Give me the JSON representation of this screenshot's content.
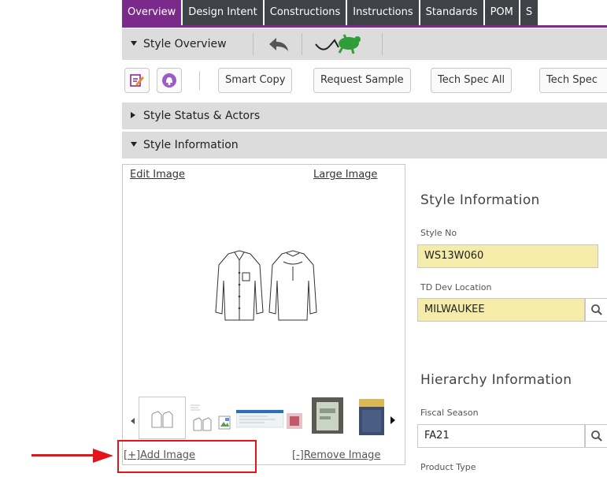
{
  "tabs": [
    {
      "label": "Overview",
      "active": true
    },
    {
      "label": "Design Intent",
      "active": false
    },
    {
      "label": "Constructions",
      "active": false
    },
    {
      "label": "Instructions",
      "active": false
    },
    {
      "label": "Standards",
      "active": false
    },
    {
      "label": "POM",
      "active": false
    },
    {
      "label": "S",
      "active": false
    }
  ],
  "style_overview": {
    "label": "Style Overview",
    "back_icon": "back-arrow-icon",
    "logo_icon": "frog-logo-icon"
  },
  "toolbar": {
    "edit_icon": "edit-note-icon",
    "alert_icon": "bell-icon",
    "smart_copy": "Smart Copy",
    "request_sample": "Request Sample",
    "tech_spec_all": "Tech Spec All",
    "tech_spec": "Tech Spec"
  },
  "sections": {
    "status_actors": "Style Status & Actors",
    "style_information": "Style Information"
  },
  "image_panel": {
    "edit_image": "Edit Image",
    "large_image": "Large Image",
    "add_image": "[+]Add Image",
    "remove_image": "[-]Remove Image",
    "main_image_icon": "shirt-sketch-icon"
  },
  "form": {
    "style_info_heading": "Style Information",
    "style_no_label": "Style No",
    "style_no_value": "WS13W060",
    "td_dev_location_label": "TD Dev Location",
    "td_dev_location_value": "MILWAUKEE",
    "hierarchy_heading": "Hierarchy Information",
    "fiscal_season_label": "Fiscal Season",
    "fiscal_season_value": "FA21",
    "product_type_label": "Product Type",
    "search_icon": "magnifier-icon"
  },
  "colors": {
    "active_tab": "#7a2a8a",
    "tab": "#3f4247",
    "required_field": "#f5ecaa",
    "annotation": "#e3151a"
  }
}
